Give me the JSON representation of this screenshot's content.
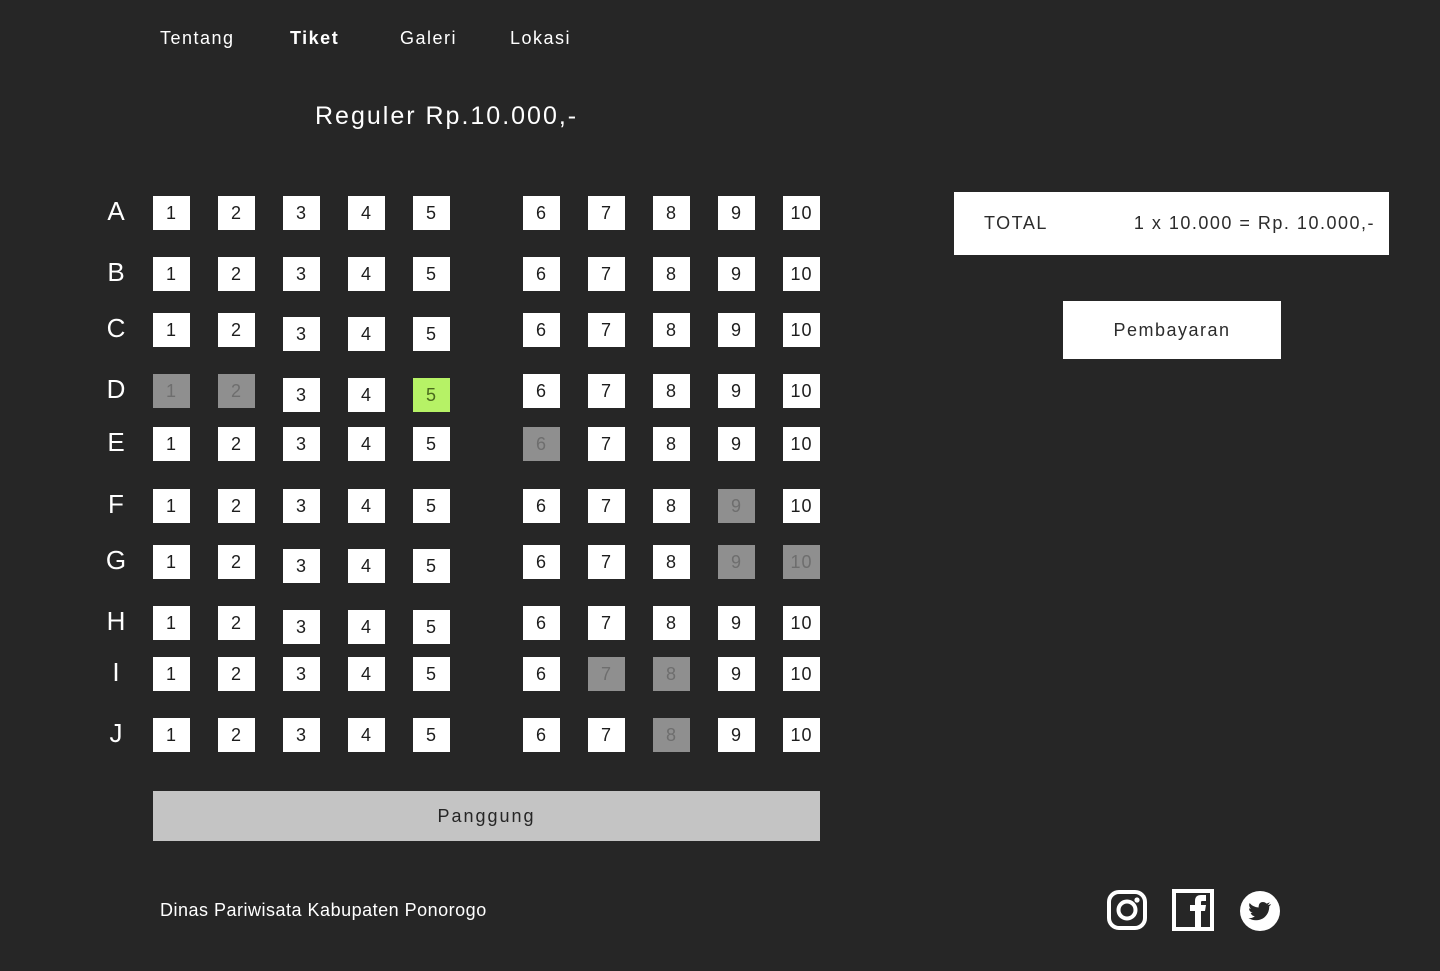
{
  "nav": {
    "items": [
      {
        "label": "Tentang",
        "active": false
      },
      {
        "label": "Tiket",
        "active": true
      },
      {
        "label": "Galeri",
        "active": false
      },
      {
        "label": "Lokasi",
        "active": false
      }
    ]
  },
  "ticket": {
    "title": "Reguler Rp.10.000,-"
  },
  "seat_map": {
    "rows": [
      {
        "label": "A",
        "seats": [
          "1",
          "2",
          "3",
          "4",
          "5",
          "6",
          "7",
          "8",
          "9",
          "10"
        ],
        "taken": [],
        "selected": []
      },
      {
        "label": "B",
        "seats": [
          "1",
          "2",
          "3",
          "4",
          "5",
          "6",
          "7",
          "8",
          "9",
          "10"
        ],
        "taken": [],
        "selected": []
      },
      {
        "label": "C",
        "seats": [
          "1",
          "2",
          "3",
          "4",
          "5",
          "6",
          "7",
          "8",
          "9",
          "10"
        ],
        "taken": [],
        "selected": []
      },
      {
        "label": "D",
        "seats": [
          "1",
          "2",
          "3",
          "4",
          "5",
          "6",
          "7",
          "8",
          "9",
          "10"
        ],
        "taken": [
          "1",
          "2"
        ],
        "selected": [
          "5"
        ]
      },
      {
        "label": "E",
        "seats": [
          "1",
          "2",
          "3",
          "4",
          "5",
          "6",
          "7",
          "8",
          "9",
          "10"
        ],
        "taken": [
          "6"
        ],
        "selected": []
      },
      {
        "label": "F",
        "seats": [
          "1",
          "2",
          "3",
          "4",
          "5",
          "6",
          "7",
          "8",
          "9",
          "10"
        ],
        "taken": [
          "9"
        ],
        "selected": []
      },
      {
        "label": "G",
        "seats": [
          "1",
          "2",
          "3",
          "4",
          "5",
          "6",
          "7",
          "8",
          "9",
          "10"
        ],
        "taken": [
          "9",
          "10"
        ],
        "selected": []
      },
      {
        "label": "H",
        "seats": [
          "1",
          "2",
          "3",
          "4",
          "5",
          "6",
          "7",
          "8",
          "9",
          "10"
        ],
        "taken": [],
        "selected": []
      },
      {
        "label": "I",
        "seats": [
          "1",
          "2",
          "3",
          "4",
          "5",
          "6",
          "7",
          "8",
          "9",
          "10"
        ],
        "taken": [
          "7",
          "8"
        ],
        "selected": []
      },
      {
        "label": "J",
        "seats": [
          "1",
          "2",
          "3",
          "4",
          "5",
          "6",
          "7",
          "8",
          "9",
          "10"
        ],
        "taken": [
          "8"
        ],
        "selected": []
      }
    ],
    "stage_label": "Panggung"
  },
  "summary": {
    "total_label": "TOTAL",
    "total_value": "1 x 10.000 = Rp. 10.000,-",
    "pay_button_label": "Pembayaran"
  },
  "footer": {
    "text": "Dinas Pariwisata Kabupaten Ponorogo",
    "social_icons": [
      "instagram-icon",
      "facebook-icon",
      "twitter-icon"
    ]
  },
  "colors": {
    "background": "#262626",
    "seat_available": "#ffffff",
    "seat_taken": "#8f8f8f",
    "seat_selected": "#b6f266",
    "stage": "#c4c4c4"
  }
}
